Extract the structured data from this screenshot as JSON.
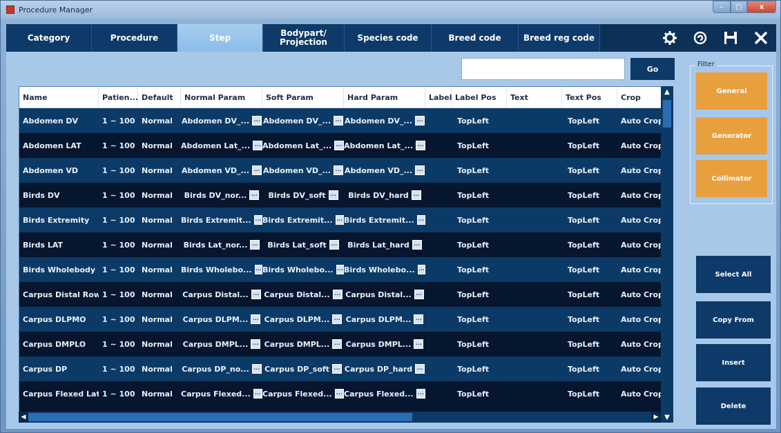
{
  "window": {
    "title": "Procedure Manager",
    "min": "–",
    "max": "□",
    "close": "x"
  },
  "tabs": [
    {
      "label": "Category"
    },
    {
      "label": "Procedure"
    },
    {
      "label": "Step"
    },
    {
      "label": "Bodypart/\nProjection"
    },
    {
      "label": "Species code"
    },
    {
      "label": "Breed code"
    },
    {
      "label": "Breed reg code"
    }
  ],
  "toolbar_icons": [
    "gear-icon",
    "refresh-icon",
    "save-icon",
    "close-icon"
  ],
  "search": {
    "value": "",
    "go_label": "Go"
  },
  "table": {
    "columns": [
      "Name",
      "Patien...",
      "Default",
      "Normal Param",
      "Soft Param",
      "Hard Param",
      "Label",
      "Label Pos",
      "Text",
      "Text Pos",
      "Crop"
    ],
    "rows": [
      [
        "Abdomen DV",
        "1 ~ 100",
        "Normal",
        "Abdomen DV_...",
        "Abdomen DV_...",
        "Abdomen DV_...",
        "",
        "TopLeft",
        "",
        "TopLeft",
        "Auto Crop"
      ],
      [
        "Abdomen LAT",
        "1 ~ 100",
        "Normal",
        "Abdomen Lat_...",
        "Abdomen Lat_...",
        "Abdomen Lat_...",
        "",
        "TopLeft",
        "",
        "TopLeft",
        "Auto Crop"
      ],
      [
        "Abdomen VD",
        "1 ~ 100",
        "Normal",
        "Abdomen VD_...",
        "Abdomen VD_...",
        "Abdomen VD_...",
        "",
        "TopLeft",
        "",
        "TopLeft",
        "Auto Crop"
      ],
      [
        "Birds DV",
        "1 ~ 100",
        "Normal",
        "Birds DV_nor...",
        "Birds DV_soft",
        "Birds DV_hard",
        "",
        "TopLeft",
        "",
        "TopLeft",
        "Auto Crop"
      ],
      [
        "Birds Extremity",
        "1 ~ 100",
        "Normal",
        "Birds Extremit...",
        "Birds Extremit...",
        "Birds Extremit...",
        "",
        "TopLeft",
        "",
        "TopLeft",
        "Auto Crop"
      ],
      [
        "Birds LAT",
        "1 ~ 100",
        "Normal",
        "Birds Lat_nor...",
        "Birds Lat_soft",
        "Birds Lat_hard",
        "",
        "TopLeft",
        "",
        "TopLeft",
        "Auto Crop"
      ],
      [
        "Birds Wholebody",
        "1 ~ 100",
        "Normal",
        "Birds Wholebo...",
        "Birds Wholebo...",
        "Birds Wholebo...",
        "",
        "TopLeft",
        "",
        "TopLeft",
        "Auto Crop"
      ],
      [
        "Carpus Distal Row sk...",
        "1 ~ 100",
        "Normal",
        "Carpus Distal...",
        "Carpus Distal...",
        "Carpus Distal...",
        "",
        "TopLeft",
        "",
        "TopLeft",
        "Auto Crop"
      ],
      [
        "Carpus DLPMO",
        "1 ~ 100",
        "Normal",
        "Carpus DLPM...",
        "Carpus DLPM...",
        "Carpus DLPM...",
        "",
        "TopLeft",
        "",
        "TopLeft",
        "Auto Crop"
      ],
      [
        "Carpus DMPLO",
        "1 ~ 100",
        "Normal",
        "Carpus DMPL...",
        "Carpus DMPL...",
        "Carpus DMPL...",
        "",
        "TopLeft",
        "",
        "TopLeft",
        "Auto Crop"
      ],
      [
        "Carpus DP",
        "1 ~ 100",
        "Normal",
        "Carpus DP_no...",
        "Carpus DP_soft",
        "Carpus DP_hard",
        "",
        "TopLeft",
        "",
        "TopLeft",
        "Auto Crop"
      ],
      [
        "Carpus Flexed Lateral",
        "1 ~ 100",
        "Normal",
        "Carpus Flexed...",
        "Carpus Flexed...",
        "Carpus Flexed...",
        "",
        "TopLeft",
        "",
        "TopLeft",
        "Auto Crop"
      ]
    ]
  },
  "filter": {
    "label": "Filter",
    "buttons": [
      "General",
      "Generator",
      "Collimator"
    ]
  },
  "actions": [
    "Select All",
    "Copy From",
    "Insert",
    "Delete"
  ],
  "colors": {
    "accent": "#e8a03f",
    "header_bg": "#0d3a68",
    "row_odd": "#0c3a66",
    "row_even": "#06162f"
  }
}
